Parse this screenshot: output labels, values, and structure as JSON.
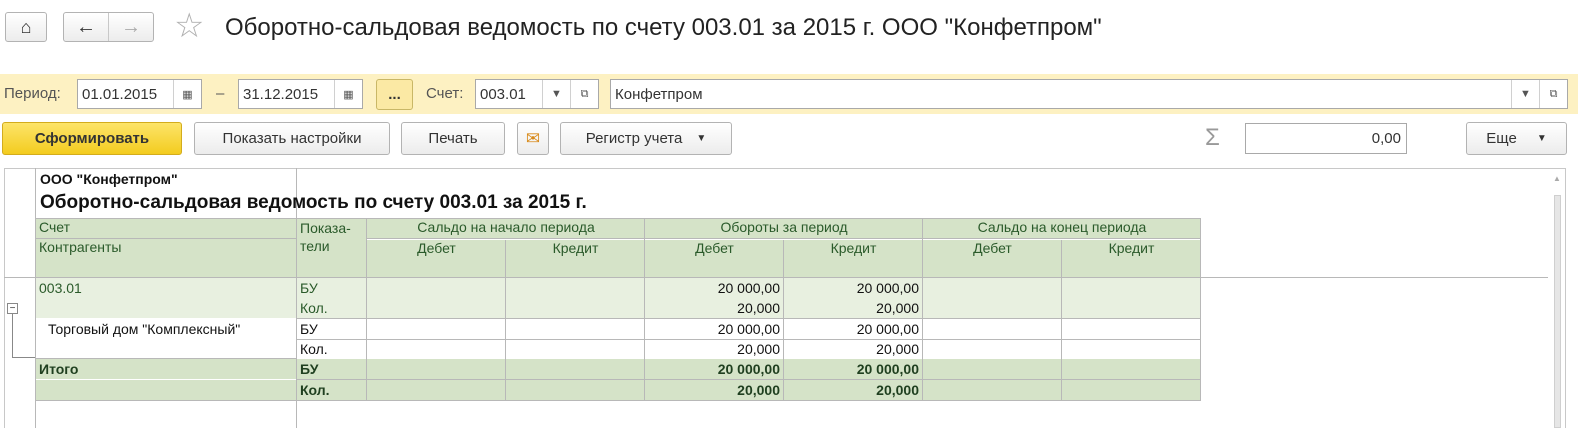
{
  "window": {
    "title": "Оборотно-сальдовая ведомость по счету 003.01 за 2015 г. ООО \"Конфетпром\""
  },
  "filters": {
    "period_label": "Период:",
    "date_from": "01.01.2015",
    "dash": "–",
    "date_to": "31.12.2015",
    "ellipsis": "...",
    "account_label": "Счет:",
    "account_value": "003.01",
    "org_value": "Конфетпром"
  },
  "toolbar": {
    "generate": "Сформировать",
    "show_settings": "Показать настройки",
    "print": "Печать",
    "register": "Регистр учета",
    "sigma": "Σ",
    "sum_value": "0,00",
    "more": "Еще"
  },
  "report": {
    "org": "ООО \"Конфетпром\"",
    "heading": "Оборотно-сальдовая ведомость по счету 003.01 за 2015 г.",
    "headers": {
      "account": "Счет",
      "contractors": "Контрагенты",
      "indicators": "Показа-\nтели",
      "opening": "Сальдо на начало периода",
      "turnover": "Обороты за период",
      "closing": "Сальдо на конец периода",
      "debit": "Дебет",
      "credit": "Кредит"
    },
    "rows": [
      {
        "account": "003.01",
        "ind": "БУ",
        "od": "",
        "oc": "",
        "td": "20 000,00",
        "tc": "20 000,00",
        "cd": "",
        "cc": ""
      },
      {
        "account": "",
        "ind": "Кол.",
        "od": "",
        "oc": "",
        "td": "20,000",
        "tc": "20,000",
        "cd": "",
        "cc": ""
      },
      {
        "account": "Торговый дом \"Комплексный\"",
        "ind": "БУ",
        "od": "",
        "oc": "",
        "td": "20 000,00",
        "tc": "20 000,00",
        "cd": "",
        "cc": ""
      },
      {
        "account": "",
        "ind": "Кол.",
        "od": "",
        "oc": "",
        "td": "20,000",
        "tc": "20,000",
        "cd": "",
        "cc": ""
      },
      {
        "account": "Итого",
        "ind": "БУ",
        "od": "",
        "oc": "",
        "td": "20 000,00",
        "tc": "20 000,00",
        "cd": "",
        "cc": ""
      },
      {
        "account": "",
        "ind": "Кол.",
        "od": "",
        "oc": "",
        "td": "20,000",
        "tc": "20,000",
        "cd": "",
        "cc": ""
      }
    ]
  },
  "colors": {
    "filter_bar": "#fdf1c2",
    "primary_button": "#f6d43c",
    "header_fill": "#d5e3c8",
    "group_fill": "#e8f0e0"
  }
}
